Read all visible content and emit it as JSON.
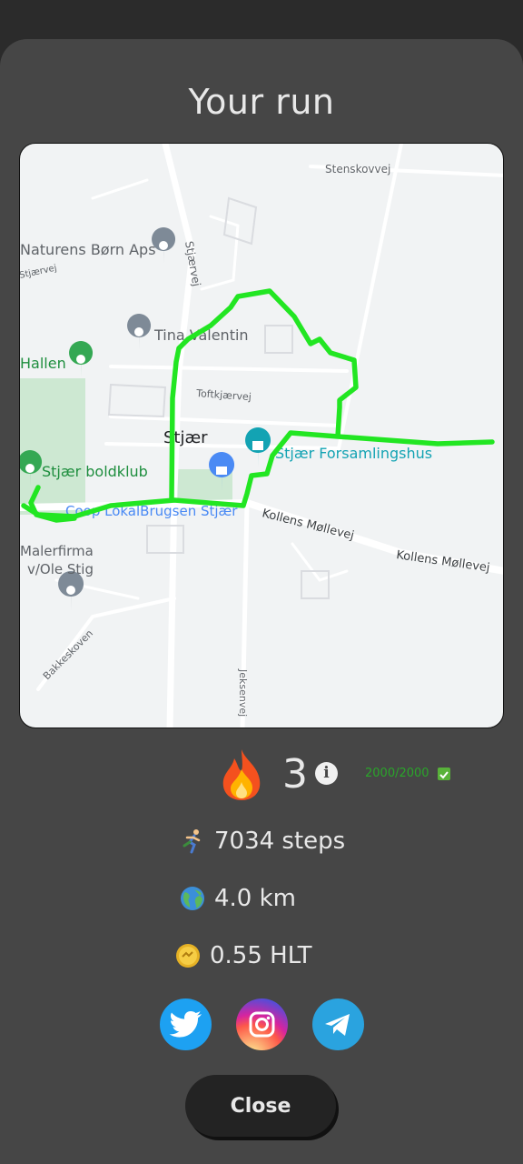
{
  "screen": {
    "title": "Your run"
  },
  "map": {
    "labels": {
      "stenskovvej": "Stenskovvej",
      "naturens": "Naturens Børn Aps",
      "stjaervej_road": "Stjærvej",
      "stjaervej_small": "Stjærvej",
      "tina": "Tina Valentin",
      "hallen": "Hallen",
      "toftkjaervej": "Toftkjærvej",
      "stjaer": "Stjær",
      "forsamlingshus": "Stjær Forsamlingshus",
      "boldklub": "Stjær boldklub",
      "coop": "Coop LokalBrugsen Stjær",
      "kollens1": "Kollens Møllevej",
      "kollens2": "Kollens Møllevej",
      "malerfirma_1": "Malerfirma",
      "malerfirma_2": "v/Ole Stig",
      "bakkeskoven": "Bakkeskoven",
      "jeksenvej": "Jeksenvej"
    },
    "route_color": "#22e622"
  },
  "streak": {
    "icon": "flame-icon",
    "value": "3",
    "info_label": "i",
    "progress": "2000/2000",
    "check_icon": "check-mark-icon"
  },
  "stats": {
    "steps": {
      "icon": "runner-icon",
      "label": "7034 steps"
    },
    "distance": {
      "icon": "globe-icon",
      "label": "4.0 km"
    },
    "reward": {
      "icon": "coin-icon",
      "label": "0.55 HLT"
    }
  },
  "share": {
    "twitter": {
      "icon": "twitter-icon",
      "color": "#1da1f2"
    },
    "instagram": {
      "icon": "instagram-icon"
    },
    "telegram": {
      "icon": "telegram-icon",
      "color": "#2aa3df"
    }
  },
  "close_button": {
    "label": "Close"
  }
}
